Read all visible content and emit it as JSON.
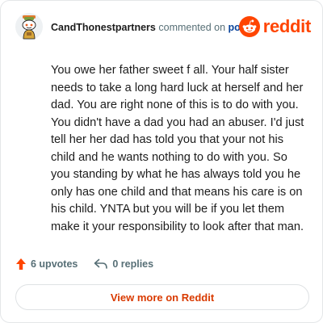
{
  "comment": {
    "username": "CandThonestpartners",
    "verb": "commented on",
    "post_link": "post",
    "body": "You owe her father sweet f all. Your half sister needs to take a long hard luck at herself and her dad. You are right none of this is to do with you. You didn't have a dad you had an abuser. I'd just tell her her dad has told you that your not his child and he wants nothing to do with you. So you standing by what he has always told you he only has one child and that means his care is on his child. YNTA but you will be if you let them make it your responsibility to look after that man.",
    "avatar_icon": "snoo-avatar-icon"
  },
  "brand": {
    "wordmark": "reddit",
    "logo_icon": "reddit-snoo-logo-icon",
    "color": "#ff4500"
  },
  "actions": {
    "upvotes_label": "6 upvotes",
    "upvote_icon": "upvote-arrow-icon",
    "upvote_color": "#ff4500",
    "replies_label": "0 replies",
    "reply_icon": "reply-arrow-icon"
  },
  "footer": {
    "view_more_label": "View more on Reddit",
    "accent": "#d93a00"
  }
}
